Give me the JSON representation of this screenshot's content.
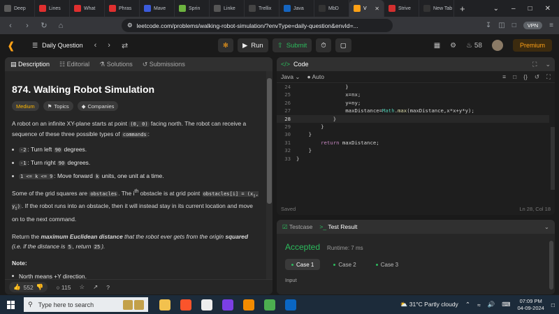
{
  "browser": {
    "tabs": [
      {
        "label": "Deep",
        "color": "#5a5a5a"
      },
      {
        "label": "Lines",
        "color": "#e02f2f"
      },
      {
        "label": "What",
        "color": "#e02f2f"
      },
      {
        "label": "Phras",
        "color": "#e02f2f"
      },
      {
        "label": "Mave",
        "color": "#3b5bdb"
      },
      {
        "label": "Sprin",
        "color": "#6db33f"
      },
      {
        "label": "Linke",
        "color": "#555555"
      },
      {
        "label": "Trellix",
        "color": "#444444"
      },
      {
        "label": "Java",
        "color": "#1565c0"
      },
      {
        "label": "MbD",
        "color": "#333333"
      },
      {
        "label": "V",
        "color": "#ffa116",
        "active": true
      },
      {
        "label": "Strive",
        "color": "#d32f2f"
      },
      {
        "label": "New Tab",
        "color": "#333333"
      }
    ],
    "url": "leetcode.com/problems/walking-robot-simulation/?envType=daily-question&envId=...",
    "vpn_label": "VPN"
  },
  "lc_nav": {
    "daily_label": "Daily Question",
    "run_label": "Run",
    "submit_label": "Submit",
    "streak": "58",
    "premium_label": "Premium"
  },
  "left": {
    "tabs": [
      "Description",
      "Editorial",
      "Solutions",
      "Submissions"
    ],
    "title": "874. Walking Robot Simulation",
    "badges": [
      "Medium",
      "Topics",
      "Companies"
    ],
    "intro_1": "A robot on an infinite XY-plane starts at point ",
    "intro_code": "(0, 0)",
    "intro_2": " facing north. The robot can receive a sequence of these three possible types of ",
    "intro_code2": "commands",
    "intro_3": ":",
    "bullets": [
      {
        "code": "-2",
        "pre": ": Turn left ",
        "code2": "90",
        "post": " degrees."
      },
      {
        "code": "-1",
        "pre": ": Turn right ",
        "code2": "90",
        "post": " degrees."
      },
      {
        "code": "1 <= k <= 9",
        "pre": ": Move forward ",
        "code2": "k",
        "post": " units, one unit at a time."
      }
    ],
    "obstacles_1": "Some of the grid squares are ",
    "obstacles_code": "obstacles",
    "obstacles_2": ". The ",
    "obstacles_sup_i": "i",
    "obstacles_sup_th": "th",
    "obstacles_3": " obstacle is at grid point ",
    "obstacles_code2": "obstacles[i] = (x",
    "obstacles_sub_i1": "i",
    "obstacles_comma": ", y",
    "obstacles_sub_i2": "i",
    "obstacles_close": ")",
    "obstacles_4": ". If the robot runs into an obstacle, then it will instead stay in its current location and move on to the next command.",
    "return_1": "Return the ",
    "return_bold": "maximum Euclidean distance",
    "return_2": " that the robot ever gets from the origin ",
    "return_bold2": "squared",
    "return_3": " (i.e. if the distance is ",
    "return_code": "5",
    "return_4": ", return ",
    "return_code2": "25",
    "return_5": ").",
    "note_label": "Note:",
    "note_item": "North means +Y direction.",
    "likes": "552",
    "comments": "115"
  },
  "code": {
    "header": "Code",
    "language": "Java",
    "mode": "Auto",
    "lines": [
      {
        "n": "24",
        "t": "                }"
      },
      {
        "n": "25",
        "t": "                x=nx;"
      },
      {
        "n": "26",
        "t": "                y=ny;"
      },
      {
        "n": "27",
        "t": "                maxDistance=Math.max(maxDistance,x*x+y*y);"
      },
      {
        "n": "28",
        "t": "            }",
        "cur": true
      },
      {
        "n": "29",
        "t": "        }"
      },
      {
        "n": "30",
        "t": "    }"
      },
      {
        "n": "31",
        "t": "        return maxDistance;"
      },
      {
        "n": "32",
        "t": "    }"
      },
      {
        "n": "33",
        "t": "}"
      }
    ],
    "saved_label": "Saved",
    "cursor_pos": "Ln 28, Col 18"
  },
  "test": {
    "tab_testcase": "Testcase",
    "tab_result": "Test Result",
    "status": "Accepted",
    "runtime": "Runtime: 7 ms",
    "cases": [
      "Case 1",
      "Case 2",
      "Case 3"
    ],
    "input_label": "Input"
  },
  "taskbar": {
    "search_placeholder": "Type here to search",
    "weather": "31°C  Partly cloudy",
    "time": "07:09 PM",
    "date": "04-09-2024"
  }
}
